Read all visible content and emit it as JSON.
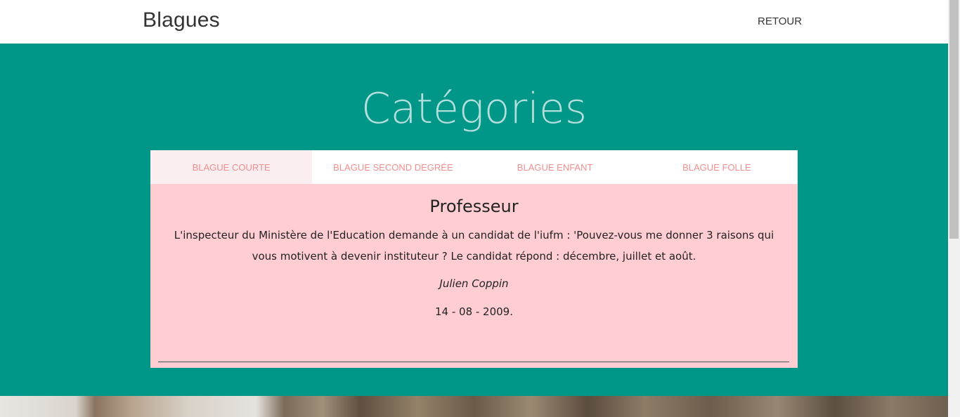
{
  "navbar": {
    "brand": "Blagues",
    "back_link": "RETOUR"
  },
  "hero": {
    "title": "Catégories"
  },
  "tabs": [
    {
      "label": "BLAGUE COURTE",
      "active": true
    },
    {
      "label": "BLAGUE SECOND DEGRÉE",
      "active": false
    },
    {
      "label": "BLAGUE ENFANT",
      "active": false
    },
    {
      "label": "BLAGUE FOLLE",
      "active": false
    }
  ],
  "joke": {
    "title": "Professeur",
    "text": "L'inspecteur du Ministère de l'Education demande à un candidat de l'iufm : 'Pouvez-vous me donner 3 raisons qui vous motivent à devenir instituteur ? Le candidat répond : décembre, juillet et août.",
    "author": "Julien Coppin",
    "date": "14 - 08 - 2009."
  },
  "colors": {
    "hero_bg": "#009688",
    "panel_bg": "#ffcdd2",
    "tab_text": "#ef8f8f"
  }
}
